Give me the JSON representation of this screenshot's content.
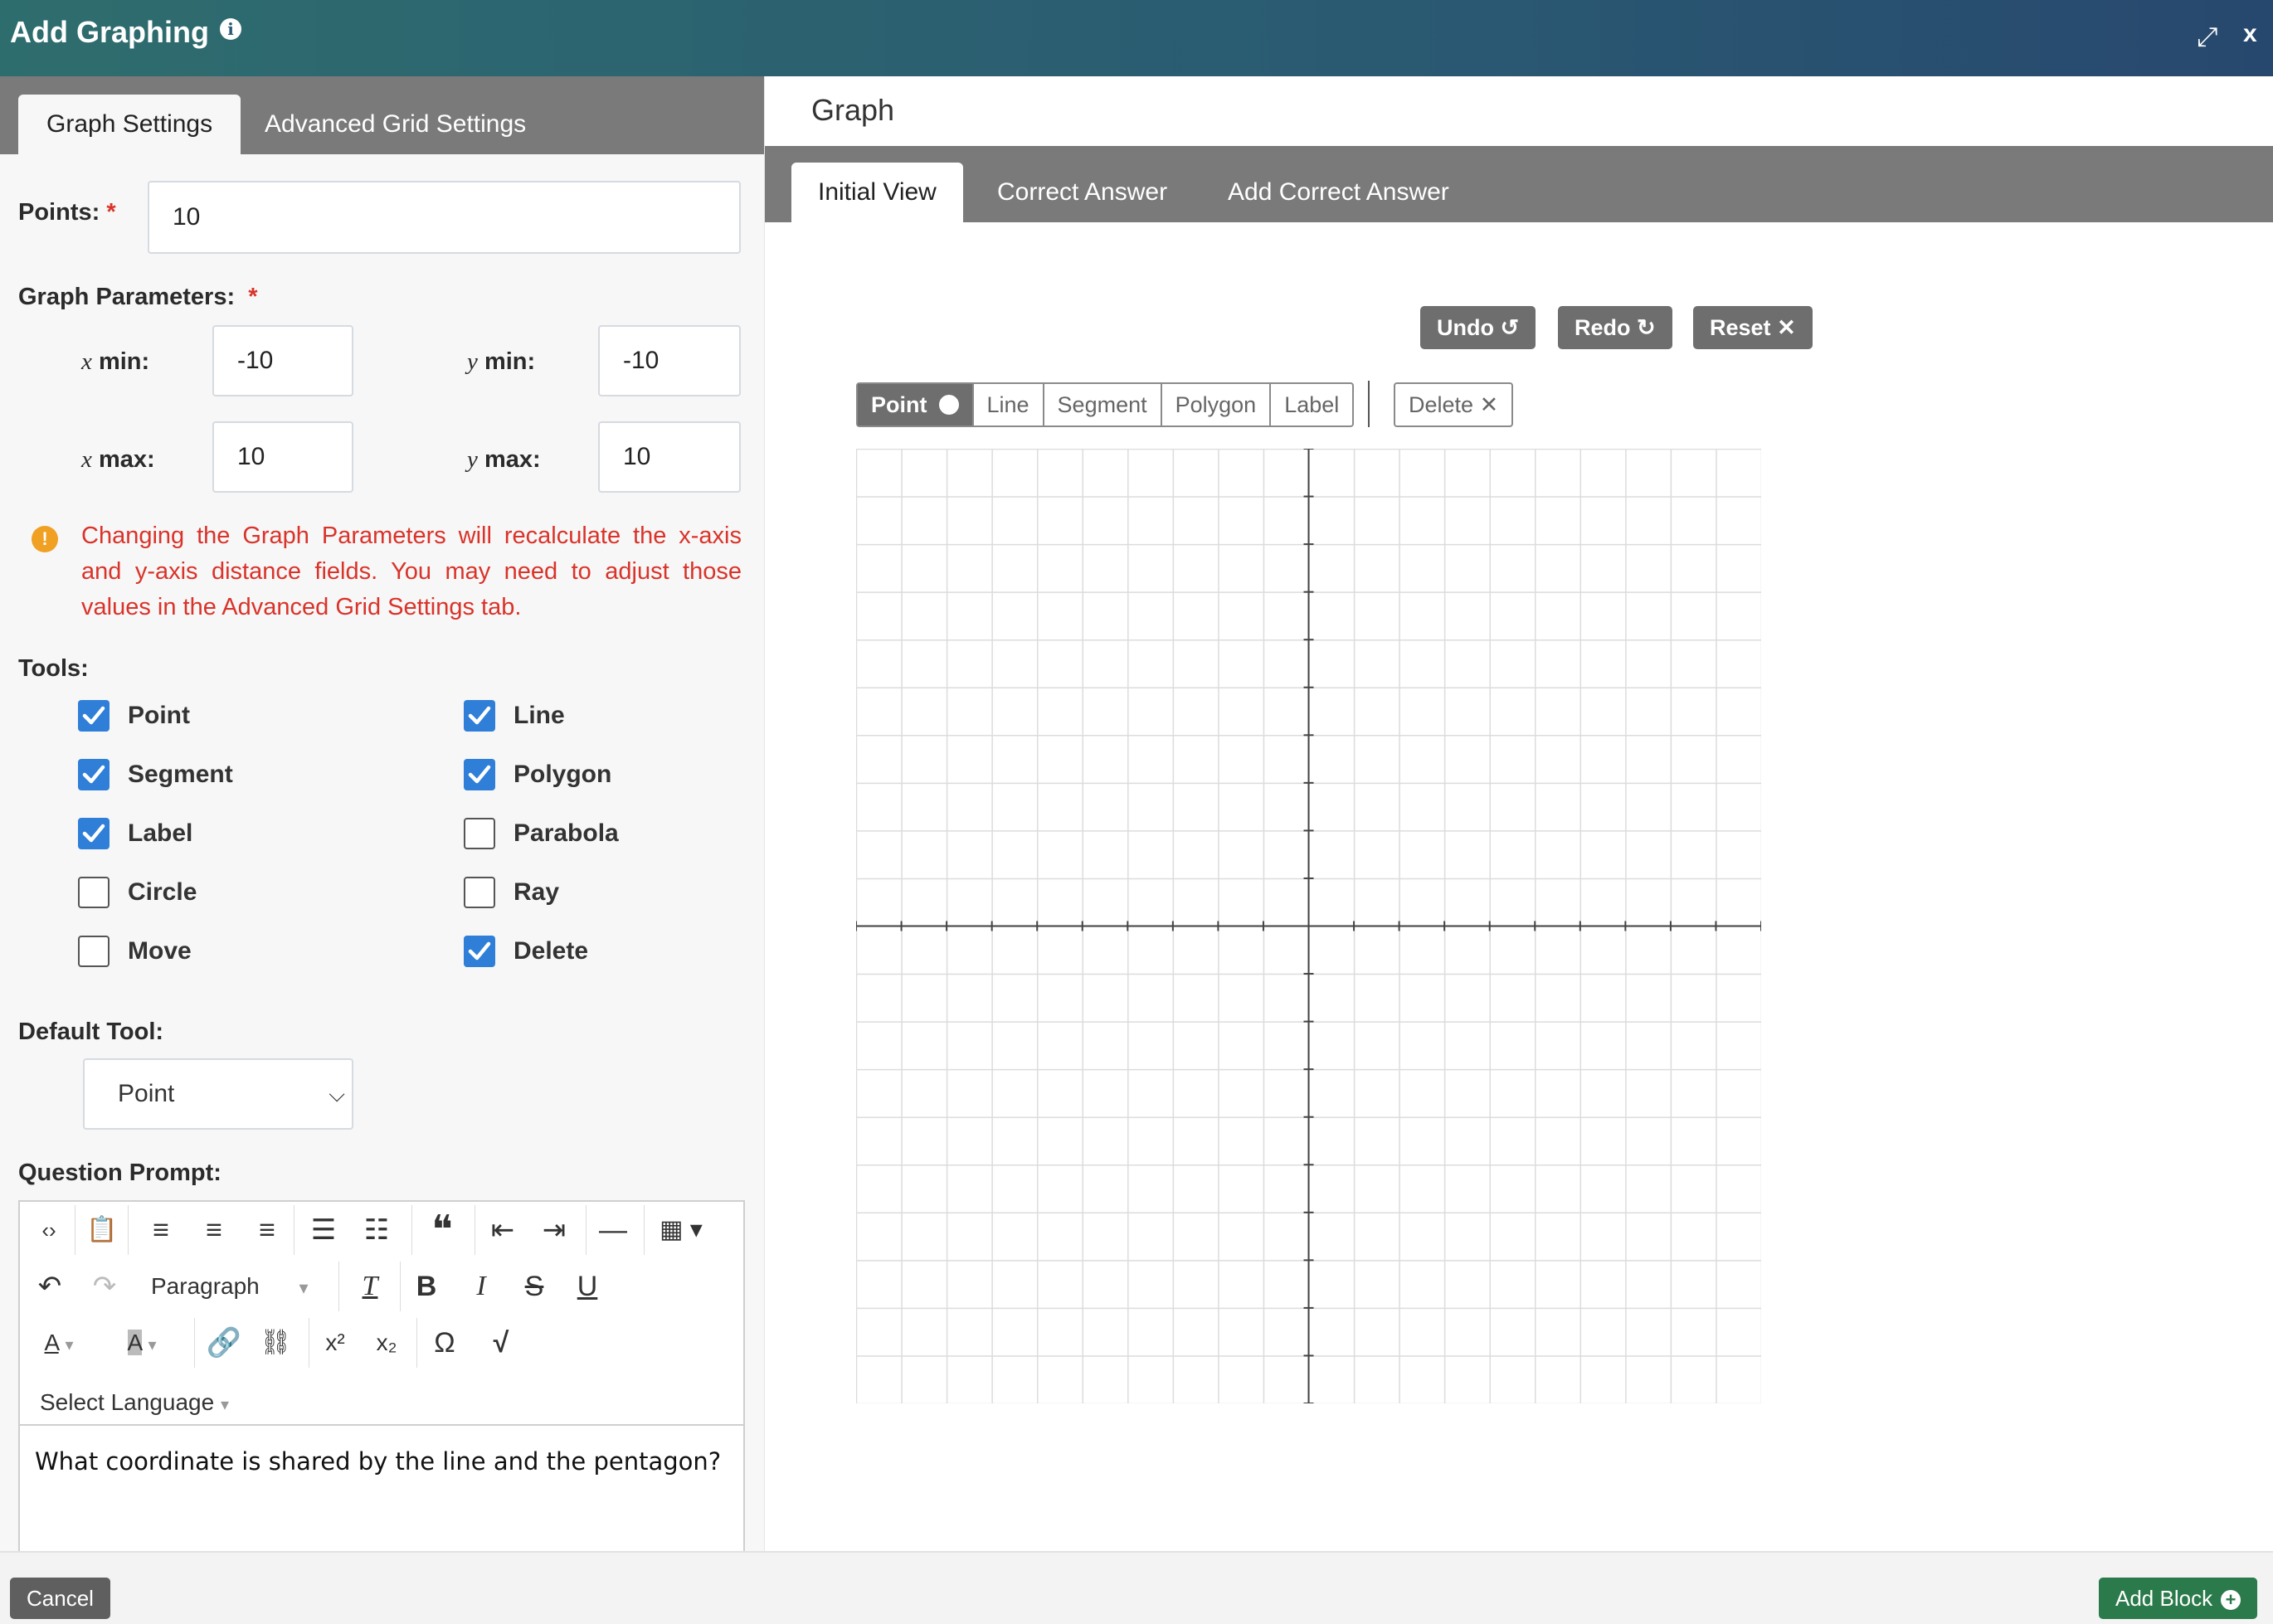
{
  "header": {
    "title": "Add Graphing",
    "info_icon": "info-icon",
    "expand_icon": "expand-icon",
    "close_label": "x"
  },
  "left_tabs": [
    "Graph Settings",
    "Advanced Grid Settings"
  ],
  "points": {
    "label": "Points:",
    "required": "*",
    "value": "10"
  },
  "graph_params": {
    "label": "Graph Parameters:",
    "required": "*",
    "xmin_label": "min:",
    "xmin": "-10",
    "ymin_label": "min:",
    "ymin": "-10",
    "xmax_label": "max:",
    "xmax": "10",
    "ymax_label": "max:",
    "ymax": "10",
    "x_var": "x",
    "y_var": "y"
  },
  "warning": "Changing the Graph Parameters will recalculate the x-axis and y-axis distance fields. You may need to adjust those values in the Advanced Grid Settings tab.",
  "tools": {
    "label": "Tools:",
    "items": [
      {
        "label": "Point",
        "checked": true
      },
      {
        "label": "Line",
        "checked": true
      },
      {
        "label": "Segment",
        "checked": true
      },
      {
        "label": "Polygon",
        "checked": true
      },
      {
        "label": "Label",
        "checked": true
      },
      {
        "label": "Parabola",
        "checked": false
      },
      {
        "label": "Circle",
        "checked": false
      },
      {
        "label": "Ray",
        "checked": false
      },
      {
        "label": "Move",
        "checked": false
      },
      {
        "label": "Delete",
        "checked": true
      }
    ]
  },
  "default_tool": {
    "label": "Default Tool:",
    "value": "Point"
  },
  "prompt": {
    "label": "Question Prompt:",
    "format": "Paragraph",
    "language": "Select Language",
    "text": "What coordinate is shared by the line and the pentagon?"
  },
  "graph": {
    "title": "Graph",
    "tabs": [
      "Initial View",
      "Correct Answer",
      "Add Correct Answer"
    ],
    "undo": "Undo",
    "redo": "Redo",
    "reset": "Reset",
    "tools": [
      "Point",
      "Line",
      "Segment",
      "Polygon",
      "Label"
    ],
    "delete": "Delete",
    "x_range": [
      -10,
      10
    ],
    "y_range": [
      -10,
      10
    ]
  },
  "footer": {
    "cancel": "Cancel",
    "add_block": "Add Block"
  }
}
